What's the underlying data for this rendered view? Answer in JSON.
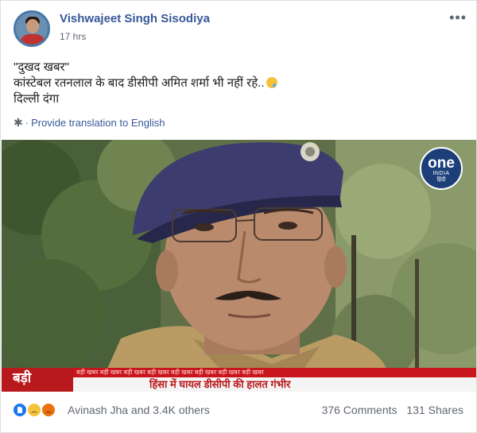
{
  "post": {
    "author": "Vishwajeet Singh Sisodiya",
    "time": "17 hrs",
    "text_lines": [
      "\"दुखद खबर\"",
      "कांस्टेबल रतनलाल के बाद डीसीपी अमित शर्मा भी नहीं रहे..",
      "दिल्ली दंगा"
    ],
    "translate_link": "Provide translation to English"
  },
  "media": {
    "logo": {
      "brand": "one",
      "sub": "INDIA",
      "hindi": "हिंदी"
    },
    "ticker": {
      "badge": "बड़ी",
      "strip": "बड़ी खबर  बड़ी खबर  बड़ी खबर  बड़ी खबर  बड़ी खबर  बड़ी खबर  बड़ी खबर  बड़ी खबर",
      "headline": "हिंसा में घायल डीसीपी की हालत गंभीर"
    }
  },
  "footer": {
    "reaction_text": "Avinash Jha and 3.4K others",
    "comments": "376 Comments",
    "shares": "131 Shares"
  },
  "icons": {
    "more": "more-icon",
    "gear": "gear-icon",
    "reactions": [
      "like-icon",
      "sad-icon",
      "angry-icon"
    ]
  },
  "colors": {
    "link": "#385898",
    "muted": "#606770",
    "news_red": "#b8191c",
    "logo_blue": "#1d3f79"
  }
}
